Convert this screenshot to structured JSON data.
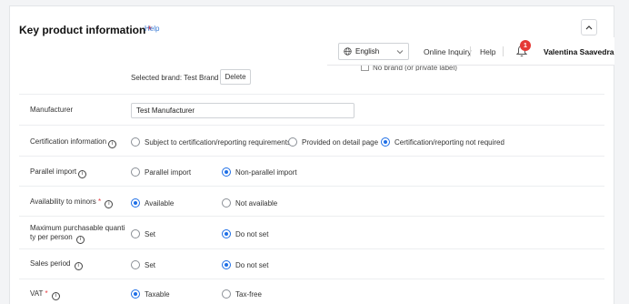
{
  "section": {
    "title": "Key product information",
    "required_mark": "*",
    "help_label": "Help"
  },
  "header": {
    "language": "English",
    "online_inquiry": "Online Inquiry",
    "help": "Help",
    "notification_count": "1",
    "user_name": "Valentina Saavedra"
  },
  "brand": {
    "selected_text": "Selected brand: Test Brand",
    "delete_label": "Delete",
    "no_brand_label": "No brand (or private label)"
  },
  "manufacturer": {
    "label": "Manufacturer",
    "value": "Test Manufacturer"
  },
  "certification": {
    "label": "Certification information",
    "options": [
      "Subject to certification/reporting requirements",
      "Provided on detail page",
      "Certification/reporting not required"
    ]
  },
  "parallel_import": {
    "label": "Parallel import",
    "options": [
      "Parallel import",
      "Non-parallel import"
    ]
  },
  "minors": {
    "label": "Availability to minors",
    "required_mark": "*",
    "options": [
      "Available",
      "Not available"
    ]
  },
  "max_purchase": {
    "label_line1": "Maximum purchasable quanti",
    "label_line2": "ty per person",
    "options": [
      "Set",
      "Do not set"
    ]
  },
  "sales_period": {
    "label": "Sales period",
    "options": [
      "Set",
      "Do not set"
    ]
  },
  "vat": {
    "label": "VAT",
    "required_mark": "*",
    "options": [
      "Taxable",
      "Tax-free"
    ]
  }
}
